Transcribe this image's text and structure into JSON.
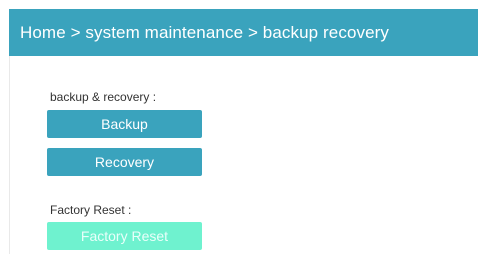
{
  "breadcrumb": "Home > system maintenance > backup recovery",
  "backup_section": {
    "label": "backup & recovery :",
    "backup_button": "Backup",
    "recovery_button": "Recovery"
  },
  "reset_section": {
    "label": "Factory Reset :",
    "reset_button": "Factory Reset"
  },
  "colors": {
    "header_bg": "#3aa3bd",
    "primary_button": "#3aa3bd",
    "reset_button": "#6ff2cf"
  }
}
